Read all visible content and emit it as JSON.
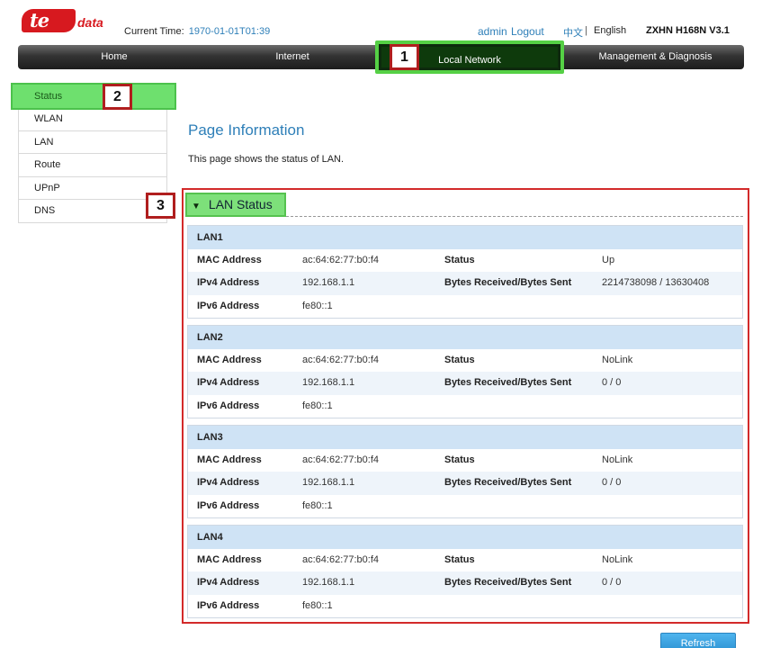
{
  "brand": {
    "logo_mark": "te",
    "logo_word": "data",
    "model": "ZXHN H168N V3.1"
  },
  "header": {
    "current_time_label": "Current Time:",
    "current_time_value": "1970-01-01T01:39",
    "user": "admin",
    "logout": "Logout",
    "lang_cn": "中文",
    "lang_sep": "|",
    "lang_en": "English"
  },
  "nav": {
    "items": [
      {
        "label": "Home"
      },
      {
        "label": "Internet"
      },
      {
        "label": "Local Network",
        "active": true
      },
      {
        "label": "Management & Diagnosis"
      }
    ]
  },
  "callouts": [
    "1",
    "2",
    "3"
  ],
  "sidebar": {
    "items": [
      {
        "label": "Status",
        "active": true
      },
      {
        "label": "WLAN"
      },
      {
        "label": "LAN"
      },
      {
        "label": "Route"
      },
      {
        "label": "UPnP"
      },
      {
        "label": "DNS"
      }
    ]
  },
  "main": {
    "title": "Page Information",
    "description": "This page shows the status of LAN.",
    "section_title": "LAN Status",
    "labels": {
      "mac": "MAC Address",
      "ipv4": "IPv4 Address",
      "ipv6": "IPv6 Address",
      "status": "Status",
      "bytes": "Bytes Received/Bytes Sent"
    },
    "lans": [
      {
        "name": "LAN1",
        "mac": "ac:64:62:77:b0:f4",
        "status": "Up",
        "ipv4": "192.168.1.1",
        "bytes": "2214738098 / 13630408",
        "ipv6": "fe80::1"
      },
      {
        "name": "LAN2",
        "mac": "ac:64:62:77:b0:f4",
        "status": "NoLink",
        "ipv4": "192.168.1.1",
        "bytes": "0 / 0",
        "ipv6": "fe80::1"
      },
      {
        "name": "LAN3",
        "mac": "ac:64:62:77:b0:f4",
        "status": "NoLink",
        "ipv4": "192.168.1.1",
        "bytes": "0 / 0",
        "ipv6": "fe80::1"
      },
      {
        "name": "LAN4",
        "mac": "ac:64:62:77:b0:f4",
        "status": "NoLink",
        "ipv4": "192.168.1.1",
        "bytes": "0 / 0",
        "ipv6": "fe80::1"
      }
    ],
    "refresh": "Refresh"
  },
  "colors": {
    "accent": "#2e7fb8",
    "brand_red": "#d7191f",
    "highlight_green": "#6ee06e",
    "callout_red": "#b01e1e"
  }
}
